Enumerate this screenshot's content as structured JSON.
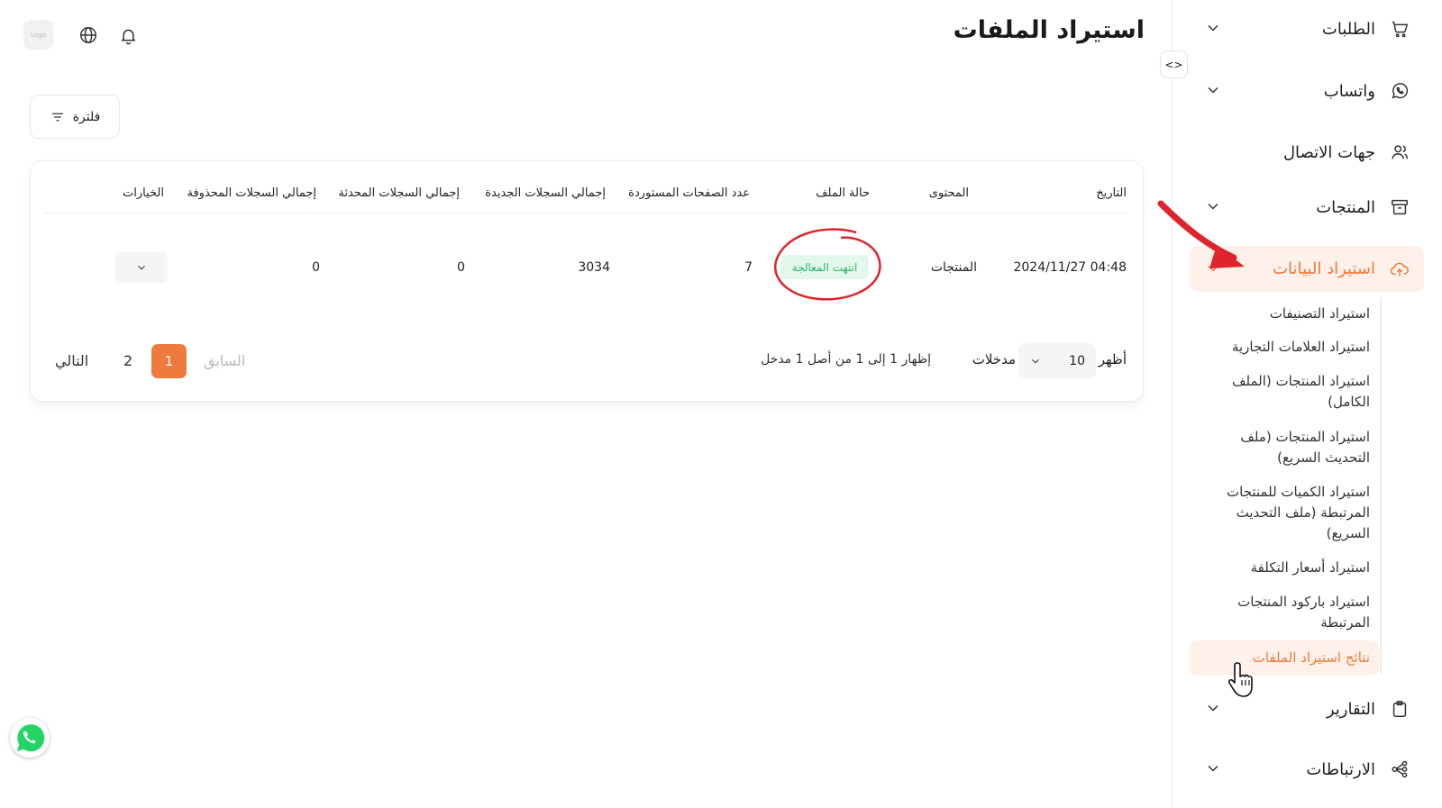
{
  "page_title": "استيراد الملفات",
  "header": {
    "avatar_text": "Logo"
  },
  "filter": {
    "label": "فلترة"
  },
  "table": {
    "headers": [
      "التاريخ",
      "المحتوى",
      "حالة الملف",
      "عدد الصفحات المستوردة",
      "إجمالي السجلات الجديدة",
      "إجمالي السجلات المحدثة",
      "إجمالي السجلات المحذوفة",
      "الخيارات"
    ],
    "rows": [
      {
        "date": "04:48 2024/11/27",
        "content": "المنتجات",
        "status": "انتهت المعالجة",
        "pages": "7",
        "new_records": "3034",
        "updated_records": "0",
        "deleted_records": "0"
      }
    ]
  },
  "pagination": {
    "show_label": "أظهر",
    "page_size": "10",
    "entries_label": "مدخلات",
    "info": "إظهار 1 إلى 1 من أصل 1 مدخل",
    "prev": "السابق",
    "pages": [
      "1",
      "2"
    ],
    "next": "التالي"
  },
  "sidebar": {
    "items": [
      {
        "label": "الطلبات",
        "icon": "cart-icon"
      },
      {
        "label": "واتساب",
        "icon": "whatsapp-icon"
      },
      {
        "label": "جهات الاتصال",
        "icon": "users-icon"
      },
      {
        "label": "المنتجات",
        "icon": "archive-icon"
      },
      {
        "label": "استيراد البيانات",
        "icon": "cloud-upload-icon"
      },
      {
        "label": "التقارير",
        "icon": "clipboard-icon"
      },
      {
        "label": "الارتباطات",
        "icon": "share-nodes-icon"
      }
    ],
    "subitems": [
      {
        "label": "استيراد التصنيفات"
      },
      {
        "label": "استيراد العلامات التجارية"
      },
      {
        "label": "استيراد المنتجات (الملف الكامل)"
      },
      {
        "label": "استيراد المنتجات (ملف التحديث السريع)"
      },
      {
        "label": "استيراد الكميات للمنتجات المرتبطة (ملف التحديث السريع)"
      },
      {
        "label": "استيراد أسعار التكلفة"
      },
      {
        "label": "استيراد باركود المنتجات المرتبطة"
      },
      {
        "label": "نتائج استيراد الملفات"
      }
    ]
  },
  "colors": {
    "accent": "#ee7a3d",
    "accent_bg": "#fdf1ea",
    "success": "#2cb56b",
    "success_bg": "#e3f8ea",
    "annotation": "#e0242b"
  }
}
